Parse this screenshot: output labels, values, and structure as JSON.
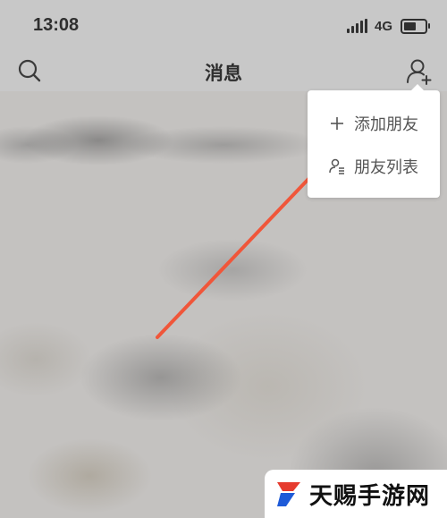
{
  "status_bar": {
    "time": "13:08",
    "network": "4G",
    "battery_level": 0.6
  },
  "header": {
    "title": "消息",
    "left_icon": "search-icon",
    "right_icon": "add-friend-icon"
  },
  "dropdown_menu": {
    "items": [
      {
        "label": "添加朋友",
        "icon": "plus-icon"
      },
      {
        "label": "朋友列表",
        "icon": "friend-list-icon"
      }
    ]
  },
  "annotation": {
    "arrow_color": "#f0563a"
  },
  "watermark": {
    "text": "天赐手游网",
    "logo_colors": [
      "#e63b2e",
      "#1e5bd8"
    ]
  }
}
